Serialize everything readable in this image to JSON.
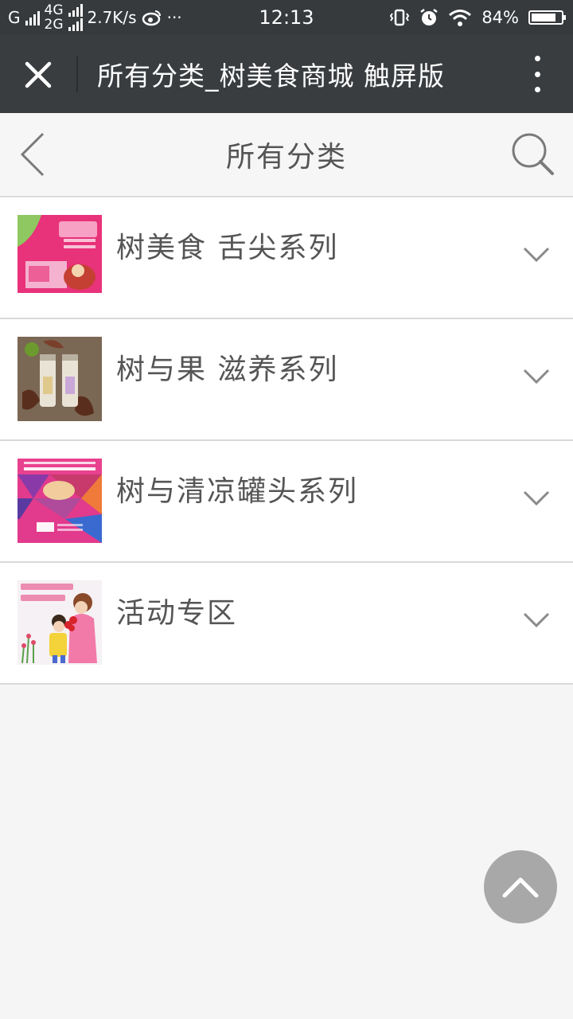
{
  "status_bar": {
    "carrier1": "G",
    "network_top": "4G",
    "network_bottom": "2G",
    "speed": "2.7K/s",
    "more_dots": "···",
    "time": "12:13",
    "battery_text": "84%",
    "battery_level": 0.84
  },
  "app_bar": {
    "title": "所有分类_树美食商城 触屏版",
    "close_icon": "close-icon",
    "more_icon": "more-vertical-icon"
  },
  "page_header": {
    "title": "所有分类",
    "back_icon": "chevron-left-icon",
    "search_icon": "search-icon"
  },
  "categories": [
    {
      "name": "树美食 舌尖系列",
      "thumb": "pink-product-box-image"
    },
    {
      "name": "树与果 滋养系列",
      "thumb": "dried-fruit-jars-image"
    },
    {
      "name": "树与清凉罐头系列",
      "thumb": "colorful-geometric-poster-image"
    },
    {
      "name": "活动专区",
      "thumb": "qixi-couple-illustration-image"
    }
  ],
  "back_to_top_icon": "chevron-up-icon"
}
